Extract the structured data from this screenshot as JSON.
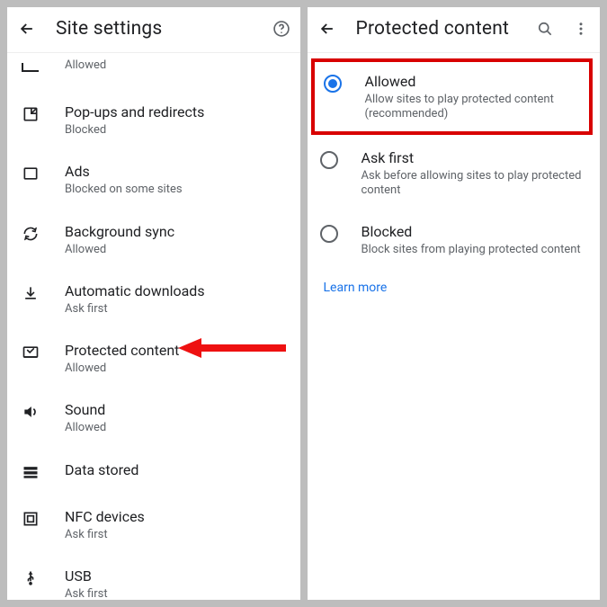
{
  "left": {
    "title": "Site settings",
    "javascript_status": "Allowed",
    "items": [
      {
        "label": "Pop-ups and redirects",
        "status": "Blocked"
      },
      {
        "label": "Ads",
        "status": "Blocked on some sites"
      },
      {
        "label": "Background sync",
        "status": "Allowed"
      },
      {
        "label": "Automatic downloads",
        "status": "Ask first"
      },
      {
        "label": "Protected content",
        "status": "Allowed"
      },
      {
        "label": "Sound",
        "status": "Allowed"
      },
      {
        "label": "Data stored",
        "status": ""
      },
      {
        "label": "NFC devices",
        "status": "Ask first"
      },
      {
        "label": "USB",
        "status": "Ask first"
      }
    ]
  },
  "right": {
    "title": "Protected content",
    "options": [
      {
        "label": "Allowed",
        "desc": "Allow sites to play protected content (recommended)",
        "checked": true
      },
      {
        "label": "Ask first",
        "desc": "Ask before allowing sites to play protected content",
        "checked": false
      },
      {
        "label": "Blocked",
        "desc": "Block sites from playing protected content",
        "checked": false
      }
    ],
    "learn_more": "Learn more"
  }
}
